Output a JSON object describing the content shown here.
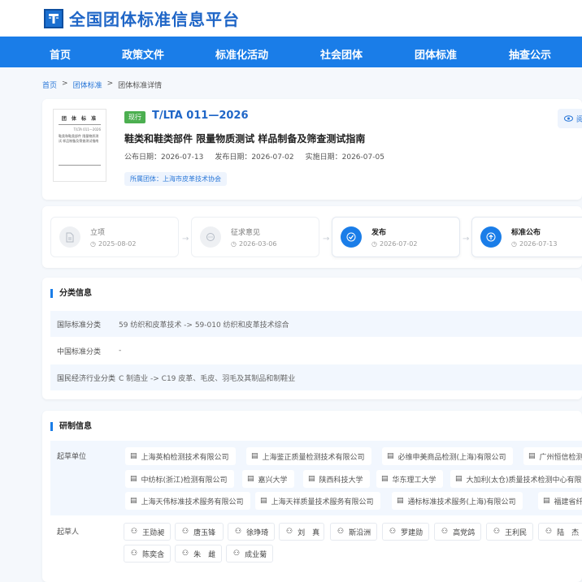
{
  "site": {
    "title": "全国团体标准信息平台"
  },
  "nav": [
    {
      "label": "首页"
    },
    {
      "label": "政策文件"
    },
    {
      "label": "标准化活动"
    },
    {
      "label": "社会团体"
    },
    {
      "label": "团体标准"
    },
    {
      "label": "抽查公示"
    }
  ],
  "breadcrumb": {
    "home": "首页",
    "sep": ">",
    "level2": "团体标准",
    "current": "团体标准详情"
  },
  "standard": {
    "status": "现行",
    "code": "T/LTA 011—2026",
    "title": "鞋类和鞋类部件 限量物质测试 样品制备及筛查测试指南",
    "publish_date": "公布日期：2026-07-13",
    "release_date": "发布日期：2026-07-02",
    "implement_date": "实施日期：2026-07-05",
    "org": "所属团体：上海市皮革技术协会",
    "view_label": "阅",
    "thumb": {
      "header": "团 体 标 准",
      "code": "T/LTA 011—2026",
      "title": "鞋类和鞋类部件 限量物质测试 样品制备及筛查测试指南"
    }
  },
  "timeline": [
    {
      "label": "立项",
      "date": "2025-08-02",
      "state": "done"
    },
    {
      "label": "征求意见",
      "date": "2026-03-06",
      "state": "done"
    },
    {
      "label": "发布",
      "date": "2026-07-02",
      "state": "active"
    },
    {
      "label": "标准公布",
      "date": "2026-07-13",
      "state": "active"
    }
  ],
  "classification": {
    "title": "分类信息",
    "rows": [
      {
        "key": "国际标准分类",
        "value": "59 纺织和皮革技术 -> 59-010 纺织和皮革技术综合"
      },
      {
        "key": "中国标准分类",
        "value": "-"
      },
      {
        "key": "国民经济行业分类",
        "value": "C 制造业 -> C19 皮革、毛皮、羽毛及其制品和制鞋业"
      }
    ]
  },
  "development": {
    "title": "研制信息",
    "units_label": "起草单位",
    "units": [
      "上海英柏检测技术有限公司",
      "上海鉴正质量检测技术有限公司",
      "必维申美商品检测(上海)有限公司",
      "广州恒信检测",
      "中纺标(浙江)检测有限公司",
      "嘉兴大学",
      "陕西科技大学",
      "华东理工大学",
      "大加利(太仓)质量技术检测中心有限",
      "上海天伟标准技术服务有限公司",
      "上海天祥质量技术服务有限公司",
      "通标标准技术服务(上海)有限公司",
      "福建省纤"
    ],
    "people_label": "起草人",
    "people": [
      "王勋昶",
      "唐玉锋",
      "徐琤琦",
      "刘　真",
      "斯沿洲",
      "罗建勋",
      "高党鸽",
      "王利民",
      "陆　杰",
      "陈奕含",
      "朱　雌",
      "成业菊"
    ]
  },
  "colors": {
    "brand": "#1a7de8",
    "status_green": "#4caf50"
  }
}
